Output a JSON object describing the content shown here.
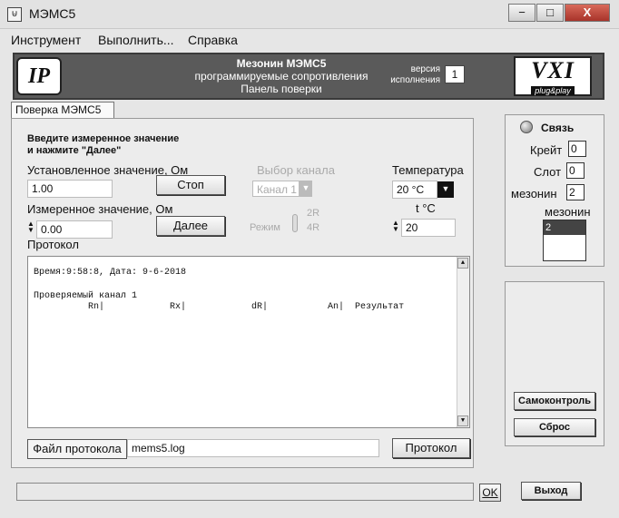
{
  "window": {
    "title": "МЭМС5",
    "icon": "app-window-icon",
    "controls": {
      "minimize": "−",
      "maximize": "□",
      "close": "X"
    }
  },
  "menu": [
    "Инструмент",
    "Выполнить...",
    "Справка"
  ],
  "header": {
    "line1": "Мезонин МЭМС5",
    "line2": "программируемые сопротивления",
    "line3": "Панель поверки",
    "version_label": "версия исполнения",
    "version_value": "1",
    "logo_left": "IP",
    "logo_right_big": "VXI",
    "logo_right_small": "plug&play"
  },
  "tab": "Поверка МЭМС5",
  "instructions": {
    "line1": "Введите измеренное значение",
    "line2": "и нажмите \"Далее\""
  },
  "set_value": {
    "label": "Установленное значение, Ом",
    "value": "1.00",
    "button": "Стоп"
  },
  "measured_value": {
    "label": "Измеренное значение, Ом",
    "value": "0.00",
    "button": "Далее"
  },
  "channel": {
    "label": "Выбор канала",
    "value": "Канал 1"
  },
  "mode": {
    "label": "Режим",
    "opt_top": "2R",
    "opt_bottom": "4R"
  },
  "temperature": {
    "label": "Температура",
    "value": "20 °C",
    "t_label": "t °C",
    "t_value": "20"
  },
  "protocol": {
    "label": "Протокол",
    "lines": [
      "Время:9:58:8, Дата: 9-6-2018",
      "",
      "Проверяемый канал 1",
      "          Rn|            Rx|            dR|           An|  Результат"
    ]
  },
  "file": {
    "label": "Файл протокола",
    "value": "mems5.log",
    "button": "Протокол"
  },
  "right_panel": {
    "connection": "Связь",
    "crate_label": "Крейт",
    "crate_value": "0",
    "slot_label": "Слот",
    "slot_value": "0",
    "mezz_label": "мезонин",
    "mezz_value": "2",
    "list_label": "мезонин",
    "list_items": [
      "2"
    ],
    "selftest_button": "Самоконтроль",
    "reset_button": "Сброс"
  },
  "footer": {
    "ok": "OK",
    "exit": "Выход"
  }
}
